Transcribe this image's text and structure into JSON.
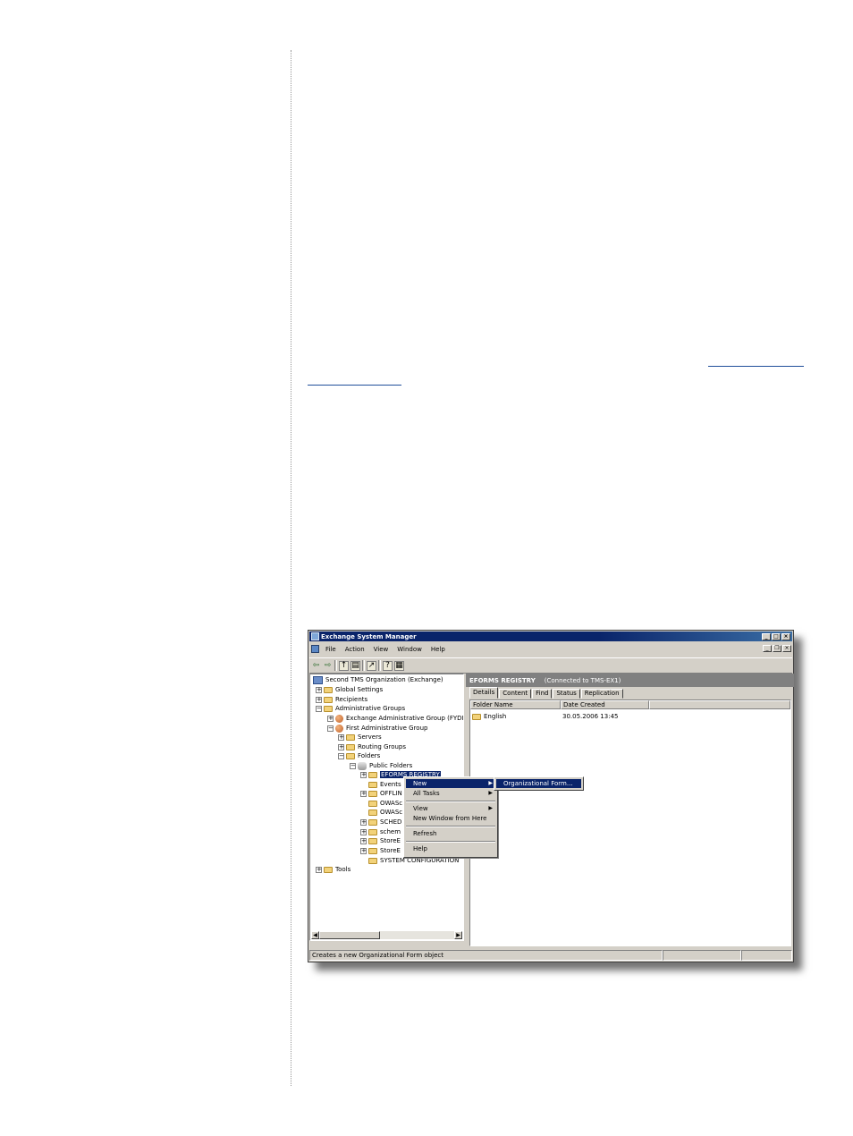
{
  "window": {
    "title": "Exchange System Manager",
    "menu": [
      "File",
      "Action",
      "View",
      "Window",
      "Help"
    ],
    "tree": {
      "root": "Second TMS Organization (Exchange)",
      "global_settings": "Global Settings",
      "recipients": "Recipients",
      "admin_groups": "Administrative Groups",
      "exchange_admin_group": "Exchange Administrative Group (FYDIBO",
      "first_admin_group": "First Administrative Group",
      "servers": "Servers",
      "routing_groups": "Routing Groups",
      "folders": "Folders",
      "public_folders": "Public Folders",
      "eforms_registry": "EFORMS REGISTRY",
      "events": "Events",
      "offline": "OFFLIN",
      "owasc1": "OWASc",
      "owasc2": "OWASc",
      "schedule": "SCHED",
      "schema": "schem",
      "storeevents1": "StoreE",
      "storeevents2": "StoreE",
      "system_configuration": "SYSTEM CONFIGURATION",
      "tools": "Tools"
    },
    "right_pane": {
      "header": "EFORMS REGISTRY",
      "connection": "(Connected to TMS-EX1)",
      "tabs": [
        "Details",
        "Content",
        "Find",
        "Status",
        "Replication"
      ],
      "columns": [
        "Folder Name",
        "Date Created"
      ],
      "rows": [
        {
          "name": "English",
          "date": "30.05.2006 13:45"
        }
      ]
    },
    "context_menu": {
      "new": "New",
      "all_tasks": "All Tasks",
      "view": "View",
      "new_window": "New Window from Here",
      "refresh": "Refresh",
      "help": "Help"
    },
    "submenu": {
      "org_form": "Organizational Form..."
    },
    "status_text": "Creates a new Organizational Form object"
  }
}
